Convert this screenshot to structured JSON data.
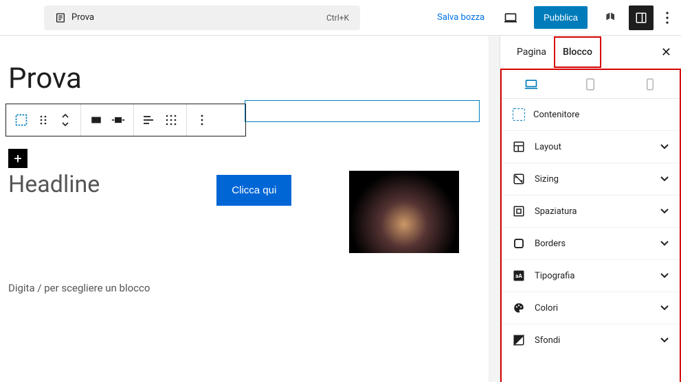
{
  "header": {
    "doc_title": "Prova",
    "shortcut": "Ctrl+K",
    "save_draft": "Salva bozza",
    "publish": "Pubblica"
  },
  "canvas": {
    "page_title": "Prova",
    "headline": "Headline",
    "cta": "Clicca qui",
    "placeholder": "Digita / per scegliere un blocco"
  },
  "sidebar": {
    "tabs": {
      "page": "Pagina",
      "block": "Blocco"
    },
    "block_name": "Contenitore",
    "sections": [
      {
        "label": "Layout"
      },
      {
        "label": "Sizing"
      },
      {
        "label": "Spaziatura"
      },
      {
        "label": "Borders"
      },
      {
        "label": "Tipografia"
      },
      {
        "label": "Colori"
      },
      {
        "label": "Sfondi"
      }
    ]
  }
}
